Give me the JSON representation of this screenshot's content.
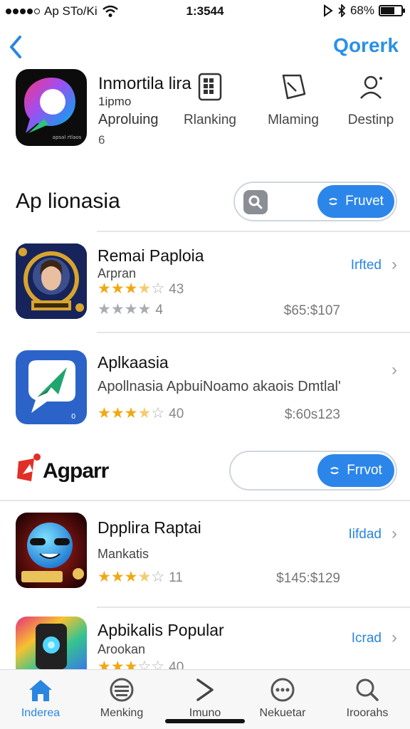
{
  "status": {
    "carrier": "Ap STo/Ki",
    "time": "1:3544",
    "battery": "68%",
    "battery_level": 0.68
  },
  "nav": {
    "back_icon": "chevron-left-icon",
    "action_label": "Qorerk"
  },
  "header": {
    "title": "Inmortila lira",
    "subtitle": "1ipmo",
    "meta_label": "Aproluing",
    "number": "6",
    "items": [
      {
        "icon": "grid-icon",
        "label": "Rlanking"
      },
      {
        "icon": "tablet-icon",
        "label": "Mlaming"
      },
      {
        "icon": "person-icon",
        "label": "Destinp"
      }
    ]
  },
  "section1": {
    "title": "Ap lionasia",
    "search_button": "Fruvet"
  },
  "section2": {
    "title": "Agparr",
    "search_button": "Frrvot"
  },
  "apps": [
    {
      "name": "Remai Paploia",
      "developer": "Arpran",
      "rating": 3.5,
      "rating_count": "43",
      "rating2": 0,
      "rating2_count": "4",
      "price": "$65:$107",
      "link": "Irfted"
    },
    {
      "name": "Aplkaasia",
      "developer": "Apollnasia ApbuiNoamo akaois Dmtlal'",
      "rating": 3.5,
      "rating_count": "40",
      "price": "$:60s123",
      "link": ""
    },
    {
      "name": "Dpplira Raptai",
      "developer": "Mankatis",
      "rating": 3.5,
      "rating_count": "11",
      "price": "$145:$129",
      "link": "Iifdad"
    },
    {
      "name": "Apbikalis Popular",
      "developer": "Arookan",
      "rating": 3.5,
      "rating_count": "40",
      "price": "",
      "link": "Icrad"
    }
  ],
  "tabs": [
    {
      "icon": "home-icon",
      "label": "Inderea",
      "active": true
    },
    {
      "icon": "layers-icon",
      "label": "Menking",
      "active": false
    },
    {
      "icon": "chevron-right-icon",
      "label": "Imuno",
      "active": false
    },
    {
      "icon": "chat-icon",
      "label": "Nekuetar",
      "active": false
    },
    {
      "icon": "search-icon",
      "label": "Iroorahs",
      "active": false
    }
  ],
  "colors": {
    "accent": "#2c86e9",
    "star": "#f1a812",
    "star_off": "#a9adb2"
  }
}
